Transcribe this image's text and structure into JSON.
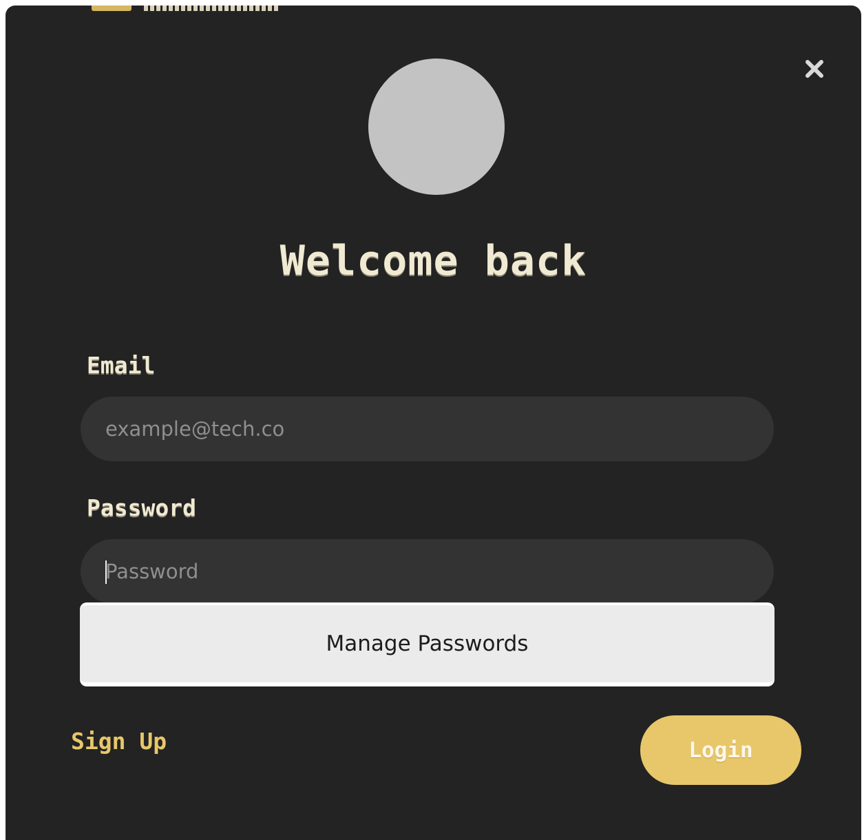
{
  "modal": {
    "close_icon": "close-icon",
    "avatar_color": "#c3c3c3",
    "title": "Welcome back"
  },
  "form": {
    "email": {
      "label": "Email",
      "placeholder": "example@tech.co",
      "value": ""
    },
    "password": {
      "label": "Password",
      "placeholder": "Password",
      "value": ""
    },
    "autofill_dropdown": {
      "item_label": "Manage Passwords"
    }
  },
  "actions": {
    "signup_label": "Sign Up",
    "login_label": "Login"
  },
  "colors": {
    "background": "#232323",
    "input_bg": "#333333",
    "accent": "#e8c76a",
    "title_text": "#f0ead2"
  }
}
